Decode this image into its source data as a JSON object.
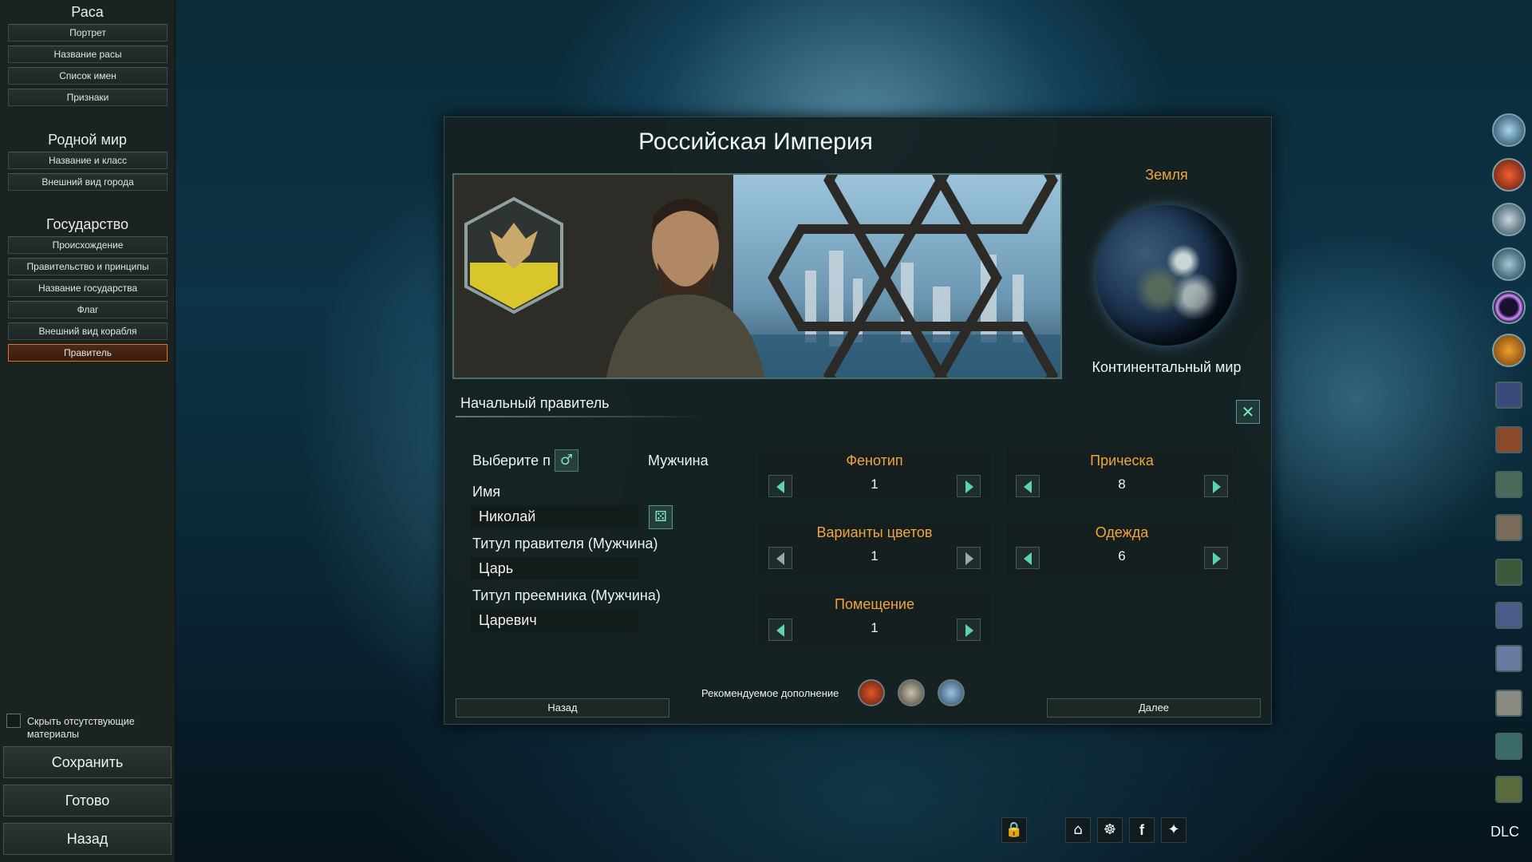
{
  "sidebar": {
    "sections": [
      {
        "title": "Раса",
        "items": [
          "Портрет",
          "Название расы",
          "Список имен",
          "Признаки"
        ]
      },
      {
        "title": "Родной мир",
        "items": [
          "Название и класс",
          "Внешний вид города"
        ]
      },
      {
        "title": "Государство",
        "items": [
          "Происхождение",
          "Правительство и принципы",
          "Название государства",
          "Флаг",
          "Внешний вид корабля",
          "Правитель"
        ]
      }
    ],
    "active_item": "Правитель",
    "hide_missing_label": "Скрыть отсутствующие материалы",
    "save_label": "Сохранить",
    "done_label": "Готово",
    "back_label": "Назад"
  },
  "main": {
    "empire_name": "Российская Империя",
    "planet_name": "Земля",
    "planet_class": "Континентальный мир",
    "ruler_section_title": "Начальный правитель",
    "gender_prompt": "Выберите п",
    "gender_value": "Мужчина",
    "name_label": "Имя",
    "name_value": "Николай",
    "ruler_title_label": "Титул правителя (Мужчина)",
    "ruler_title_value": "Царь",
    "heir_title_label": "Титул преемника (Мужчина)",
    "heir_title_value": "Царевич",
    "selectors": [
      {
        "title": "Фенотип",
        "value": "1"
      },
      {
        "title": "Прическа",
        "value": "8"
      },
      {
        "title": "Варианты цветов",
        "value": "1"
      },
      {
        "title": "Одежда",
        "value": "6"
      },
      {
        "title": "Помещение",
        "value": "1"
      }
    ],
    "recommended_dlc_label": "Рекомендуемое дополнение",
    "back_label": "Назад",
    "next_label": "Далее"
  },
  "right_column": {
    "dlc_label": "DLC"
  },
  "colors": {
    "accent_orange": "#f0a53c",
    "accent_teal": "#5fd0b8",
    "panel_bg": "#162122",
    "active_border": "#d4772c"
  }
}
